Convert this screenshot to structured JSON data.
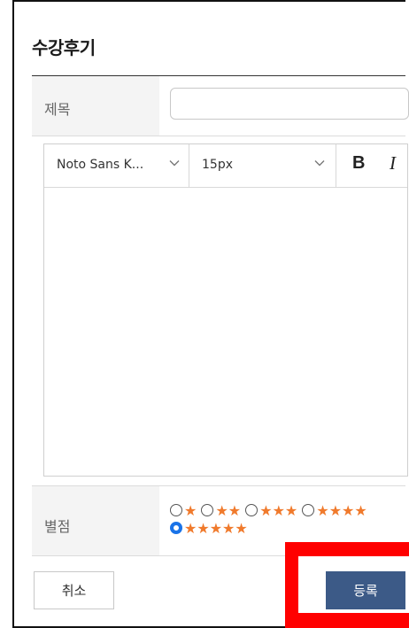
{
  "dialog": {
    "title": "수강후기"
  },
  "subject": {
    "label": "제목",
    "value": "",
    "placeholder": ""
  },
  "editor": {
    "font_family": "Noto Sans K...",
    "font_size": "15px",
    "bold_label": "B",
    "italic_label": "I",
    "body_text": ""
  },
  "rating": {
    "label": "별점",
    "options": [
      {
        "stars": "★",
        "value": 1,
        "selected": false
      },
      {
        "stars": "★★",
        "value": 2,
        "selected": false
      },
      {
        "stars": "★★★",
        "value": 3,
        "selected": false
      },
      {
        "stars": "★★★★",
        "value": 4,
        "selected": false
      },
      {
        "stars": "★★★★★",
        "value": 5,
        "selected": true
      }
    ],
    "star_color": "#f07a2c",
    "radio_checked_color": "#1a73e8"
  },
  "actions": {
    "cancel_label": "취소",
    "submit_label": "등록",
    "submit_color": "#3c5a87",
    "highlight_color": "#ff0000"
  }
}
